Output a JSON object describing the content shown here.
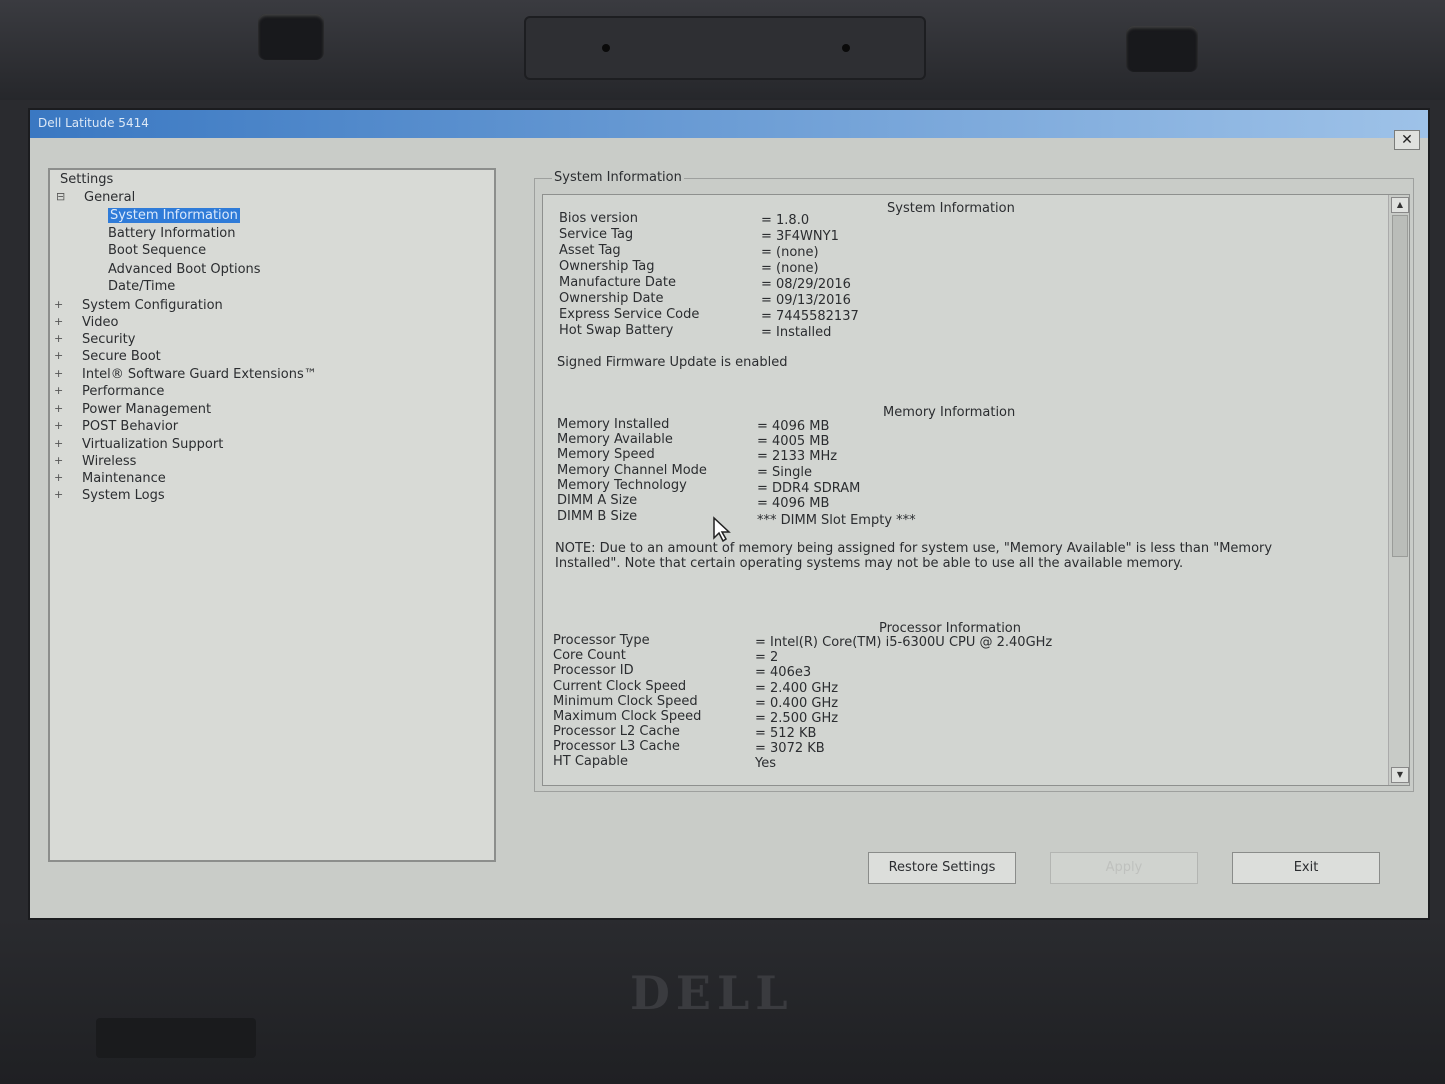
{
  "window": {
    "title": "Dell Latitude 5414",
    "close_label": "✕"
  },
  "tree": {
    "root": "Settings",
    "general": "General",
    "general_children": [
      "System Information",
      "Battery Information",
      "Boot Sequence",
      "Advanced Boot Options",
      "Date/Time"
    ],
    "groups": [
      "System Configuration",
      "Video",
      "Security",
      "Secure Boot",
      "Intel® Software Guard Extensions™",
      "Performance",
      "Power Management",
      "POST Behavior",
      "Virtualization Support",
      "Wireless",
      "Maintenance",
      "System Logs"
    ]
  },
  "panel": {
    "group_title": "System Information",
    "system_heading": "System Information",
    "system": [
      {
        "k": "Bios version",
        "v": "= 1.8.0"
      },
      {
        "k": "Service Tag",
        "v": "= 3F4WNY1"
      },
      {
        "k": "Asset Tag",
        "v": "= (none)"
      },
      {
        "k": "Ownership Tag",
        "v": "= (none)"
      },
      {
        "k": "Manufacture Date",
        "v": "= 08/29/2016"
      },
      {
        "k": "Ownership Date",
        "v": "= 09/13/2016"
      },
      {
        "k": "Express Service Code",
        "v": "= 7445582137"
      },
      {
        "k": "Hot Swap Battery",
        "v": "= Installed"
      }
    ],
    "firmware_note": "Signed Firmware Update is enabled",
    "memory_heading": "Memory Information",
    "memory": [
      {
        "k": "Memory Installed",
        "v": "= 4096 MB"
      },
      {
        "k": "Memory Available",
        "v": "= 4005 MB"
      },
      {
        "k": "Memory Speed",
        "v": "= 2133 MHz"
      },
      {
        "k": "Memory Channel Mode",
        "v": "= Single"
      },
      {
        "k": "Memory Technology",
        "v": "= DDR4 SDRAM"
      },
      {
        "k": "DIMM A Size",
        "v": "= 4096 MB"
      },
      {
        "k": "DIMM B Size",
        "v": "*** DIMM Slot Empty ***"
      }
    ],
    "memory_note": "NOTE: Due to an amount of memory being assigned for system use, \"Memory Available\" is less than \"Memory Installed\". Note that certain operating systems may not be able to use all the available memory.",
    "processor_heading": "Processor Information",
    "processor": [
      {
        "k": "Processor Type",
        "v": "= Intel(R) Core(TM) i5-6300U CPU @ 2.40GHz"
      },
      {
        "k": "Core Count",
        "v": "= 2"
      },
      {
        "k": "Processor ID",
        "v": "= 406e3"
      },
      {
        "k": "Current Clock Speed",
        "v": "= 2.400 GHz"
      },
      {
        "k": "Minimum Clock Speed",
        "v": "= 0.400 GHz"
      },
      {
        "k": "Maximum Clock Speed",
        "v": "= 2.500 GHz"
      },
      {
        "k": "Processor L2 Cache",
        "v": "= 512 KB"
      },
      {
        "k": "Processor L3 Cache",
        "v": "= 3072 KB"
      },
      {
        "k": "HT Capable",
        "v": "Yes"
      }
    ]
  },
  "buttons": {
    "restore": "Restore Settings",
    "apply": "Apply",
    "exit": "Exit"
  },
  "logo": "DELL"
}
